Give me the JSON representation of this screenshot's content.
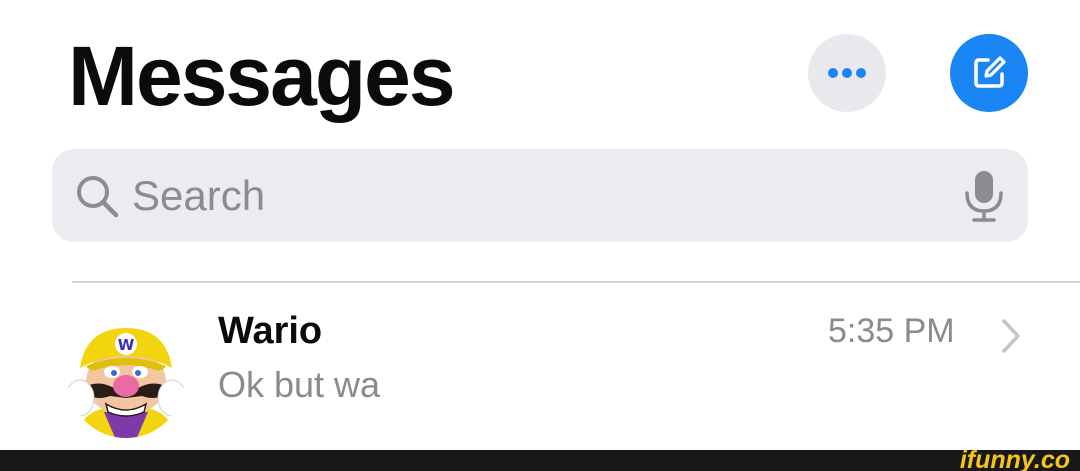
{
  "header": {
    "title": "Messages",
    "more_icon": "ellipsis-icon",
    "compose_icon": "compose-icon"
  },
  "search": {
    "placeholder": "Search",
    "value": "",
    "search_icon": "magnifying-glass-icon",
    "mic_icon": "microphone-icon"
  },
  "conversations": [
    {
      "name": "Wario",
      "preview": "Ok but wa",
      "time": "5:35 PM",
      "avatar_icon": "wario-avatar",
      "chevron_icon": "chevron-right-icon"
    }
  ],
  "watermark": "ifunny.co",
  "colors": {
    "accent": "#1a85f5",
    "search_bg": "#ececf0",
    "secondary_text": "#8a8a8f",
    "watermark": "#f5c518"
  }
}
